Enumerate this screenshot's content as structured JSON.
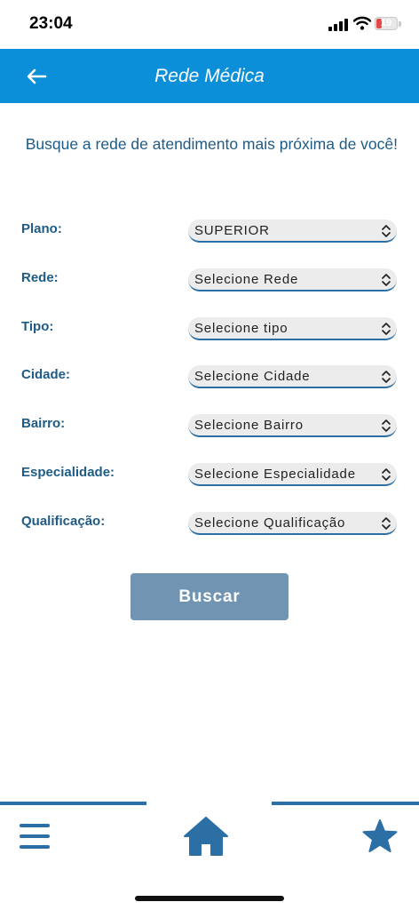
{
  "status_bar": {
    "time": "23:04",
    "battery_level": "19"
  },
  "header": {
    "title": "Rede Médica",
    "back_icon": "arrow-left-icon"
  },
  "intro": {
    "text": "Busque a rede de atendimento mais próxima de você!"
  },
  "form": {
    "fields": [
      {
        "label": "Plano:",
        "value": "SUPERIOR"
      },
      {
        "label": "Rede:",
        "value": "Selecione Rede"
      },
      {
        "label": "Tipo:",
        "value": "Selecione tipo"
      },
      {
        "label": "Cidade:",
        "value": "Selecione Cidade"
      },
      {
        "label": "Bairro:",
        "value": "Selecione Bairro"
      },
      {
        "label": "Especialidade:",
        "value": "Selecione Especialidade"
      },
      {
        "label": "Qualificação:",
        "value": "Selecione Qualificação"
      }
    ],
    "search_label": "Buscar"
  },
  "bottom_nav": {
    "items": [
      {
        "icon": "menu-icon"
      },
      {
        "icon": "home-icon"
      },
      {
        "icon": "star-icon"
      }
    ]
  },
  "colors": {
    "header_bg": "#0c8fd9",
    "text_primary": "#1e5b85",
    "accent": "#2b6fa5",
    "button_bg": "#7194b3"
  }
}
